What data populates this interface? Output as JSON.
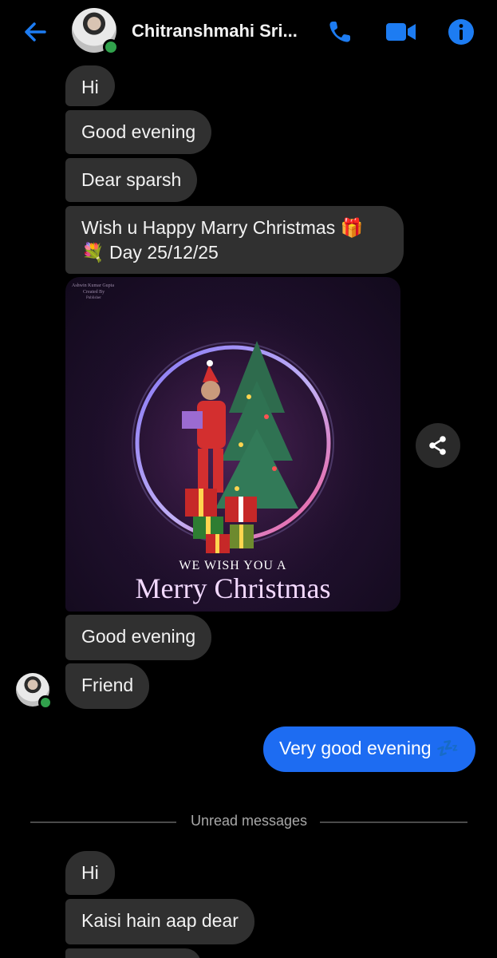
{
  "header": {
    "contact_name": "Chitranshmahi Sri...",
    "back_icon": "arrow-left-icon",
    "call_icon": "phone-icon",
    "video_icon": "video-camera-icon",
    "info_icon": "info-icon",
    "accent_color": "#1d6cf2",
    "online_color": "#31a24c"
  },
  "messages": {
    "m1": "Hi",
    "m2": "Good evening",
    "m3": "Dear sparsh",
    "m4_line1": "Wish u Happy Marry Christmas 🎁",
    "m4_line2": "💐 Day 25/12/25",
    "image_card": {
      "watermark_line1": "Ashwin Kumar Gupta",
      "watermark_line2": "Created By",
      "watermark_line3": "Publisher",
      "greeting_line1": "WE WISH YOU A",
      "greeting_line2": "Merry Christmas"
    },
    "m5": "Good evening",
    "m6": "Friend",
    "sent1": "Very good evening 💤"
  },
  "divider": {
    "label": "Unread messages"
  },
  "unread": {
    "u1": "Hi",
    "u2": "Kaisi hain aap dear"
  }
}
